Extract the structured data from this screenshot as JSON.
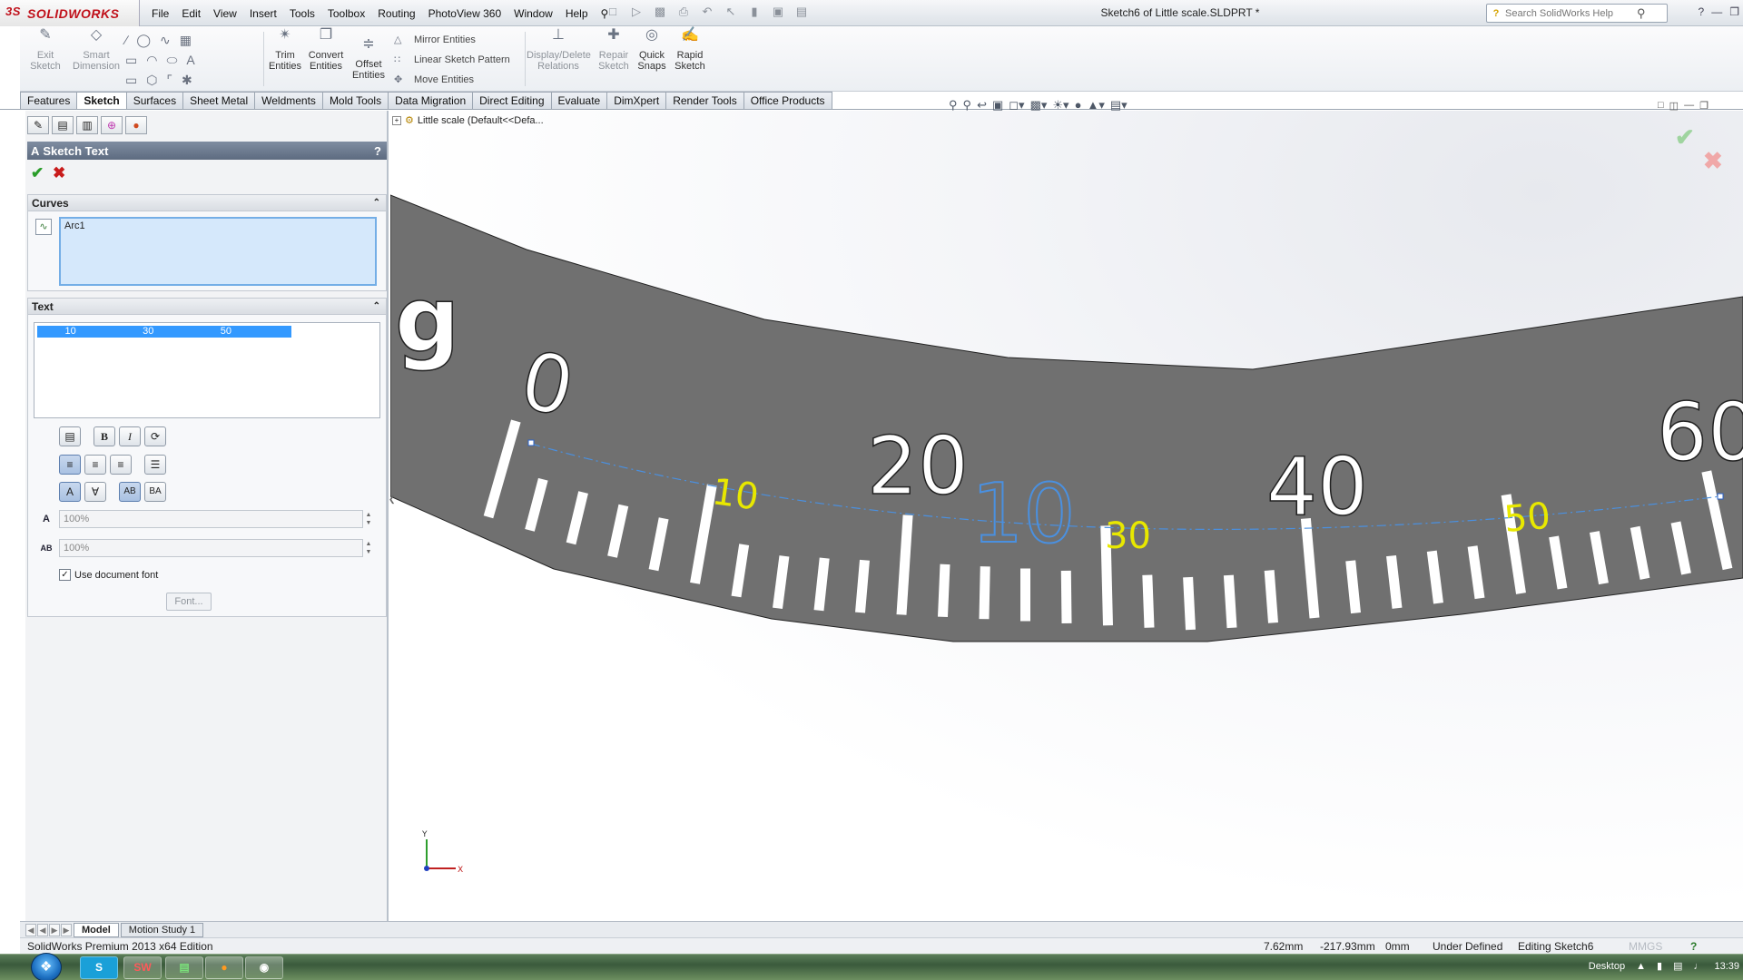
{
  "app": {
    "brand": "SOLIDWORKS",
    "brand_mark": "3S",
    "window_title": "Sketch6 of Little scale.SLDPRT *",
    "menus": [
      "File",
      "Edit",
      "View",
      "Insert",
      "Tools",
      "Toolbox",
      "Routing",
      "PhotoView 360",
      "Window",
      "Help"
    ],
    "help_search_placeholder": "Search SolidWorks Help"
  },
  "commands": {
    "exit_sketch": "Exit\nSketch",
    "smart_dimension": "Smart\nDimension",
    "trim_entities": "Trim\nEntities",
    "convert_entities": "Convert\nEntities",
    "offset_entities": "Offset\nEntities",
    "mirror_entities": "Mirror Entities",
    "linear_sketch_pattern": "Linear Sketch Pattern",
    "move_entities": "Move Entities",
    "display_delete_relations": "Display/Delete\nRelations",
    "repair_sketch": "Repair\nSketch",
    "quick_snaps": "Quick\nSnaps",
    "rapid_sketch": "Rapid\nSketch"
  },
  "tabs": [
    "Features",
    "Sketch",
    "Surfaces",
    "Sheet Metal",
    "Weldments",
    "Mold Tools",
    "Data Migration",
    "Direct Editing",
    "Evaluate",
    "DimXpert",
    "Render Tools",
    "Office Products"
  ],
  "active_tab": "Sketch",
  "property_manager": {
    "title": "Sketch Text",
    "help": "?",
    "curves": {
      "heading": "Curves",
      "selection": "Arc1"
    },
    "text": {
      "heading": "Text",
      "content": "          10                        30                        50",
      "width_factor": "100%",
      "spacing": "100%",
      "use_document_font_label": "Use document font",
      "use_document_font": true,
      "font_button": "Font..."
    }
  },
  "feature_tree": {
    "root": "Little scale  (Default<<Defa..."
  },
  "graphics": {
    "scale_color": "#707070",
    "sketch_text_color": "#e8e800",
    "arc_color": "#4a90e0",
    "big_labels": [
      "0",
      "20",
      "40",
      "60"
    ],
    "sketch_labels": [
      "10",
      "30",
      "50"
    ],
    "blue_label": "10",
    "partial_letter": "g",
    "axis_x": "X",
    "axis_y": "Y"
  },
  "bottom_tabs": [
    "Model",
    "Motion Study 1"
  ],
  "status": {
    "edition": "SolidWorks Premium 2013 x64 Edition",
    "x": "7.62mm",
    "y": "-217.93mm",
    "z": "0mm",
    "state": "Under Defined",
    "editing": "Editing Sketch6",
    "units": "MMGS"
  },
  "taskbar": {
    "desktop_label": "Desktop",
    "time": "13:39"
  }
}
